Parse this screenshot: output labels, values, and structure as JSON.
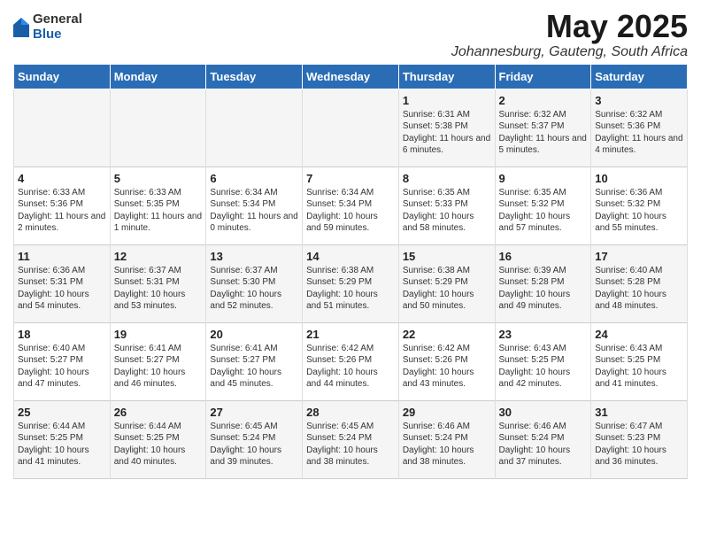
{
  "logo": {
    "general": "General",
    "blue": "Blue"
  },
  "header": {
    "month": "May 2025",
    "location": "Johannesburg, Gauteng, South Africa"
  },
  "days_of_week": [
    "Sunday",
    "Monday",
    "Tuesday",
    "Wednesday",
    "Thursday",
    "Friday",
    "Saturday"
  ],
  "weeks": [
    [
      {
        "day": "",
        "text": ""
      },
      {
        "day": "",
        "text": ""
      },
      {
        "day": "",
        "text": ""
      },
      {
        "day": "",
        "text": ""
      },
      {
        "day": "1",
        "text": "Sunrise: 6:31 AM\nSunset: 5:38 PM\nDaylight: 11 hours and 6 minutes."
      },
      {
        "day": "2",
        "text": "Sunrise: 6:32 AM\nSunset: 5:37 PM\nDaylight: 11 hours and 5 minutes."
      },
      {
        "day": "3",
        "text": "Sunrise: 6:32 AM\nSunset: 5:36 PM\nDaylight: 11 hours and 4 minutes."
      }
    ],
    [
      {
        "day": "4",
        "text": "Sunrise: 6:33 AM\nSunset: 5:36 PM\nDaylight: 11 hours and 2 minutes."
      },
      {
        "day": "5",
        "text": "Sunrise: 6:33 AM\nSunset: 5:35 PM\nDaylight: 11 hours and 1 minute."
      },
      {
        "day": "6",
        "text": "Sunrise: 6:34 AM\nSunset: 5:34 PM\nDaylight: 11 hours and 0 minutes."
      },
      {
        "day": "7",
        "text": "Sunrise: 6:34 AM\nSunset: 5:34 PM\nDaylight: 10 hours and 59 minutes."
      },
      {
        "day": "8",
        "text": "Sunrise: 6:35 AM\nSunset: 5:33 PM\nDaylight: 10 hours and 58 minutes."
      },
      {
        "day": "9",
        "text": "Sunrise: 6:35 AM\nSunset: 5:32 PM\nDaylight: 10 hours and 57 minutes."
      },
      {
        "day": "10",
        "text": "Sunrise: 6:36 AM\nSunset: 5:32 PM\nDaylight: 10 hours and 55 minutes."
      }
    ],
    [
      {
        "day": "11",
        "text": "Sunrise: 6:36 AM\nSunset: 5:31 PM\nDaylight: 10 hours and 54 minutes."
      },
      {
        "day": "12",
        "text": "Sunrise: 6:37 AM\nSunset: 5:31 PM\nDaylight: 10 hours and 53 minutes."
      },
      {
        "day": "13",
        "text": "Sunrise: 6:37 AM\nSunset: 5:30 PM\nDaylight: 10 hours and 52 minutes."
      },
      {
        "day": "14",
        "text": "Sunrise: 6:38 AM\nSunset: 5:29 PM\nDaylight: 10 hours and 51 minutes."
      },
      {
        "day": "15",
        "text": "Sunrise: 6:38 AM\nSunset: 5:29 PM\nDaylight: 10 hours and 50 minutes."
      },
      {
        "day": "16",
        "text": "Sunrise: 6:39 AM\nSunset: 5:28 PM\nDaylight: 10 hours and 49 minutes."
      },
      {
        "day": "17",
        "text": "Sunrise: 6:40 AM\nSunset: 5:28 PM\nDaylight: 10 hours and 48 minutes."
      }
    ],
    [
      {
        "day": "18",
        "text": "Sunrise: 6:40 AM\nSunset: 5:27 PM\nDaylight: 10 hours and 47 minutes."
      },
      {
        "day": "19",
        "text": "Sunrise: 6:41 AM\nSunset: 5:27 PM\nDaylight: 10 hours and 46 minutes."
      },
      {
        "day": "20",
        "text": "Sunrise: 6:41 AM\nSunset: 5:27 PM\nDaylight: 10 hours and 45 minutes."
      },
      {
        "day": "21",
        "text": "Sunrise: 6:42 AM\nSunset: 5:26 PM\nDaylight: 10 hours and 44 minutes."
      },
      {
        "day": "22",
        "text": "Sunrise: 6:42 AM\nSunset: 5:26 PM\nDaylight: 10 hours and 43 minutes."
      },
      {
        "day": "23",
        "text": "Sunrise: 6:43 AM\nSunset: 5:25 PM\nDaylight: 10 hours and 42 minutes."
      },
      {
        "day": "24",
        "text": "Sunrise: 6:43 AM\nSunset: 5:25 PM\nDaylight: 10 hours and 41 minutes."
      }
    ],
    [
      {
        "day": "25",
        "text": "Sunrise: 6:44 AM\nSunset: 5:25 PM\nDaylight: 10 hours and 41 minutes."
      },
      {
        "day": "26",
        "text": "Sunrise: 6:44 AM\nSunset: 5:25 PM\nDaylight: 10 hours and 40 minutes."
      },
      {
        "day": "27",
        "text": "Sunrise: 6:45 AM\nSunset: 5:24 PM\nDaylight: 10 hours and 39 minutes."
      },
      {
        "day": "28",
        "text": "Sunrise: 6:45 AM\nSunset: 5:24 PM\nDaylight: 10 hours and 38 minutes."
      },
      {
        "day": "29",
        "text": "Sunrise: 6:46 AM\nSunset: 5:24 PM\nDaylight: 10 hours and 38 minutes."
      },
      {
        "day": "30",
        "text": "Sunrise: 6:46 AM\nSunset: 5:24 PM\nDaylight: 10 hours and 37 minutes."
      },
      {
        "day": "31",
        "text": "Sunrise: 6:47 AM\nSunset: 5:23 PM\nDaylight: 10 hours and 36 minutes."
      }
    ]
  ]
}
